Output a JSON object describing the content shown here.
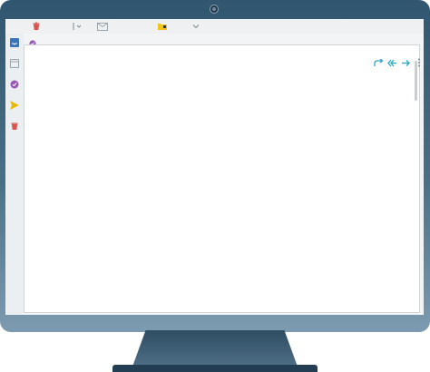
{
  "window": {
    "title": ""
  },
  "toolbar": {
    "icons": [
      "trash-icon",
      "dropdown-chevron-icon",
      "mail-icon",
      "folder-tag-icon",
      "dropdown-chevron-icon"
    ]
  },
  "sidebar": {
    "items": [
      {
        "icon": "inbox-icon"
      },
      {
        "icon": "archive-icon"
      },
      {
        "icon": "check-circle-icon"
      },
      {
        "icon": "send-icon"
      },
      {
        "icon": "trash-icon"
      }
    ]
  },
  "message_actions": [
    "reply-icon",
    "reply-all-icon",
    "forward-icon",
    "more-vertical-icon"
  ],
  "colors": {
    "monitor_frame": "#31566f",
    "screen_bg": "#f1f3f4",
    "accent_teal": "#2aa6c2",
    "trash_red": "#d9534f",
    "check_purple": "#9b59b6",
    "send_yellow": "#e6b800",
    "folder_yellow": "#f0c419"
  }
}
